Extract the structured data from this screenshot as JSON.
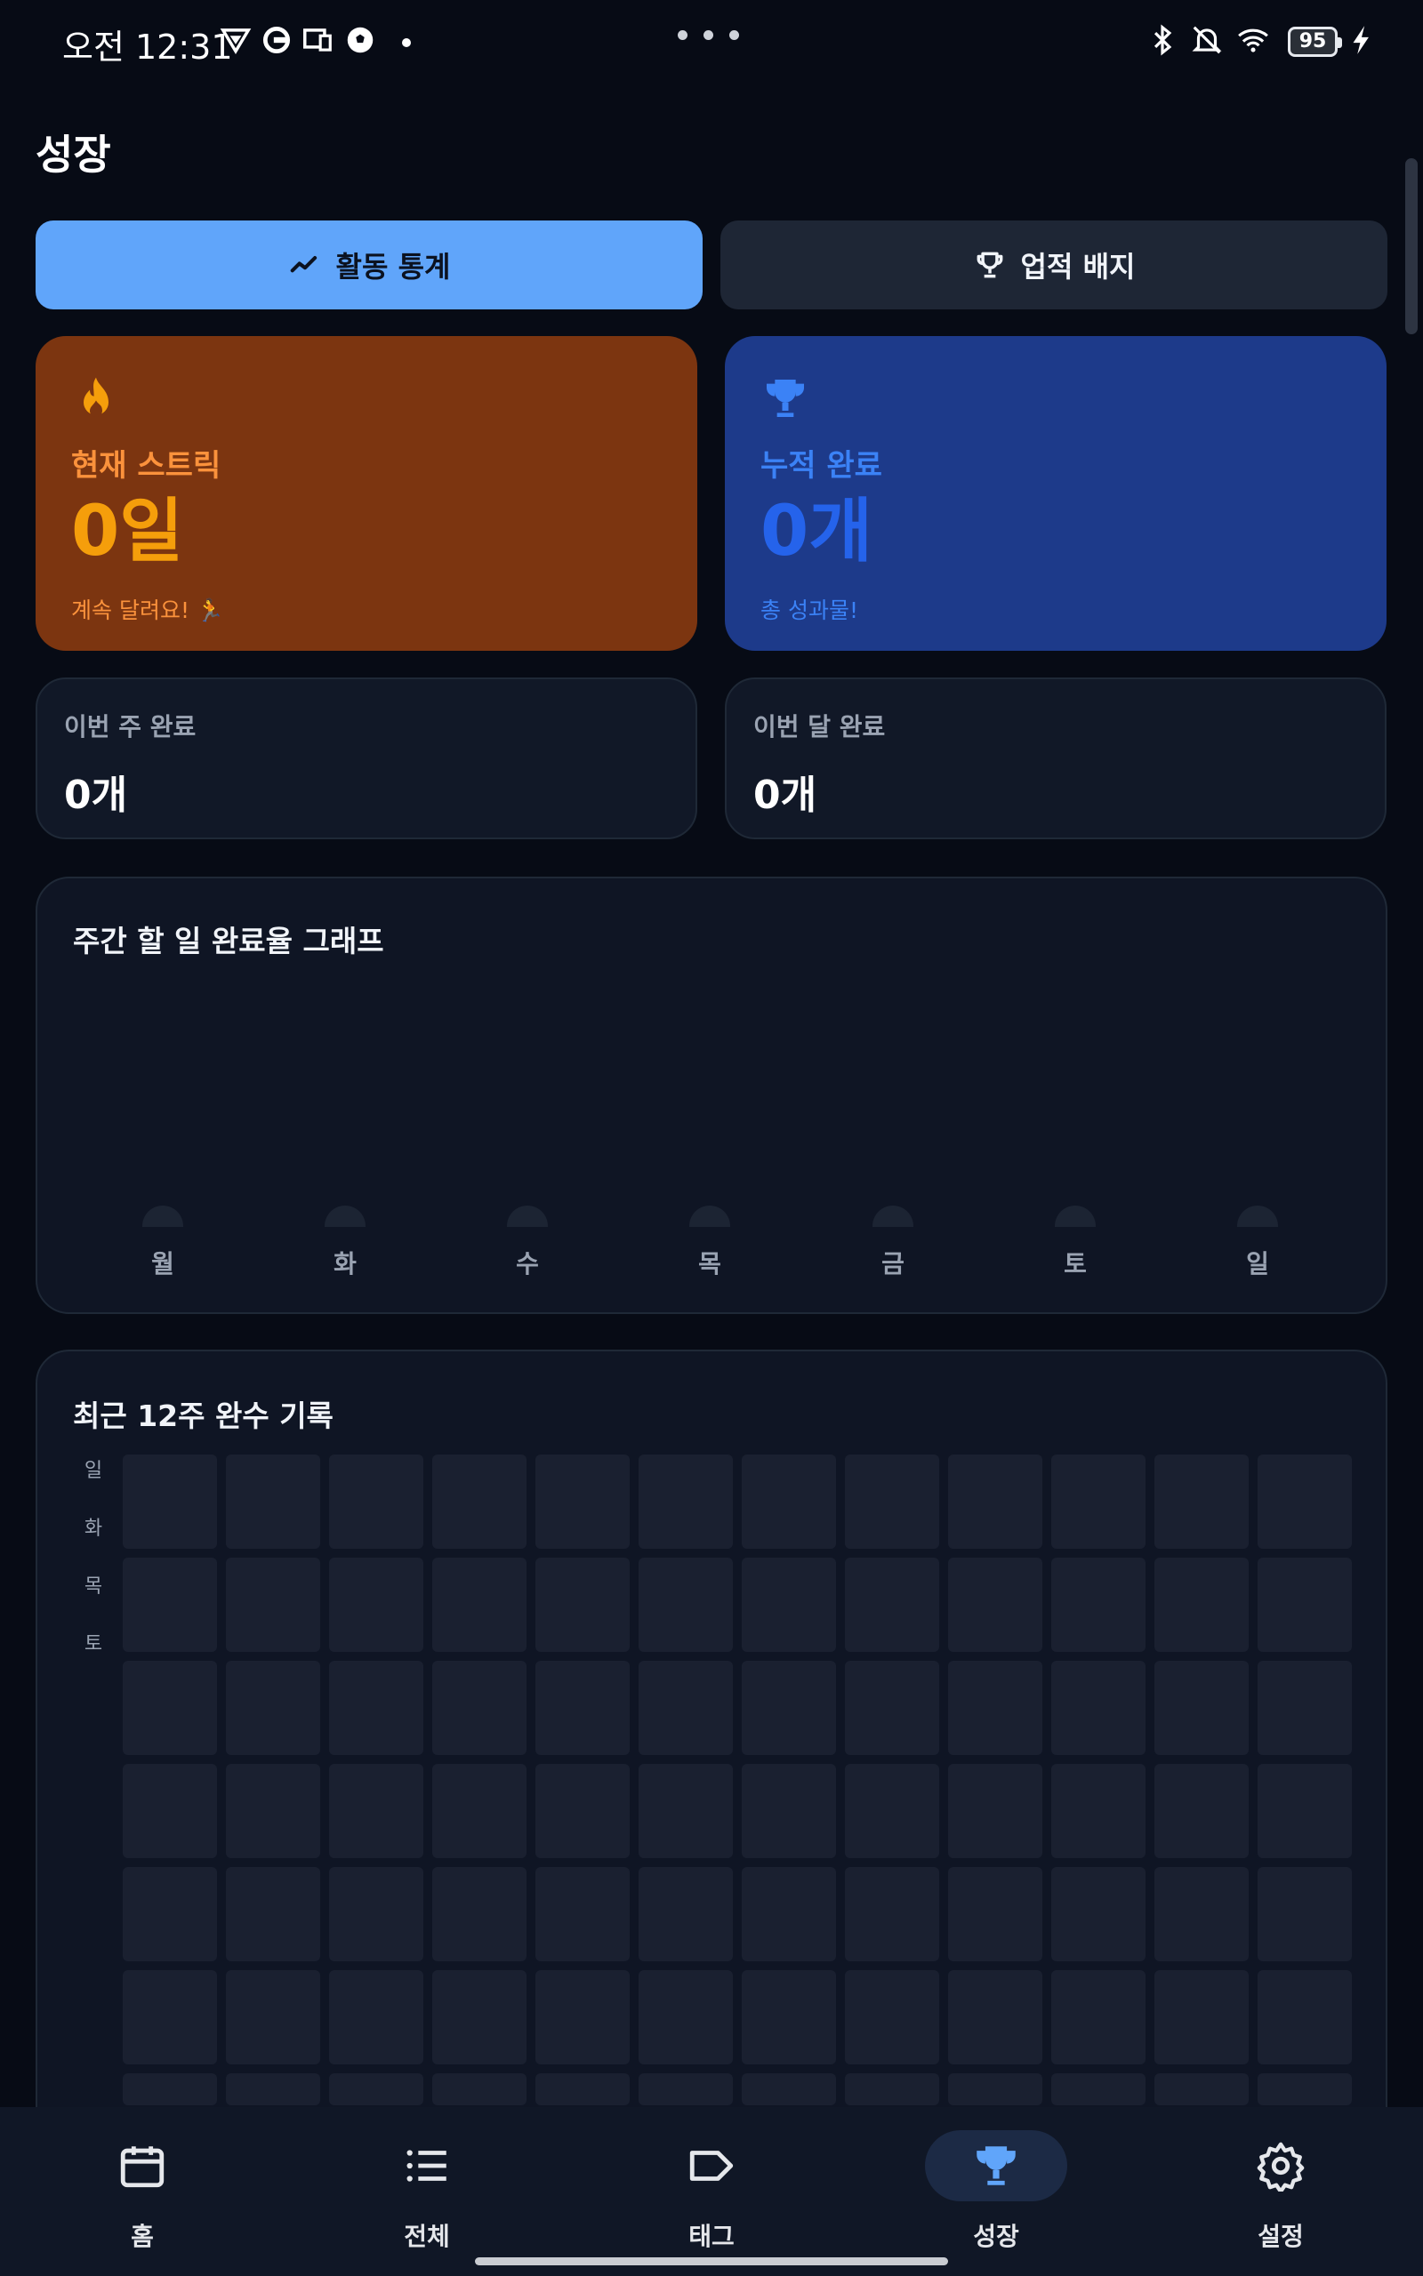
{
  "status_bar": {
    "time": "오전 12:31",
    "battery": "95",
    "icons": [
      "vpn-icon",
      "sync-icon",
      "cast-icon",
      "soccer-icon",
      "dot-icon",
      "bluetooth-icon",
      "mute-icon",
      "wifi-icon",
      "battery-icon",
      "charging-icon"
    ]
  },
  "header": {
    "title": "성장"
  },
  "tabs": [
    {
      "label": "활동 통계",
      "icon": "trend-icon",
      "active": true
    },
    {
      "label": "업적 배지",
      "icon": "trophy-icon",
      "active": false
    }
  ],
  "stats": {
    "streak": {
      "label": "현재 스트릭",
      "value": "0일",
      "sub": "계속 달려요! 🏃",
      "icon": "flame-icon",
      "color": "#7c3510"
    },
    "total": {
      "label": "누적 완료",
      "value": "0개",
      "sub": "총 성과물!",
      "icon": "trophy-icon",
      "color": "#1d3a8a"
    },
    "week": {
      "label": "이번 주 완료",
      "value": "0개"
    },
    "month": {
      "label": "이번 달 완료",
      "value": "0개"
    }
  },
  "weekly_graph": {
    "title": "주간 할 일 완료율 그래프",
    "days": [
      "월",
      "화",
      "수",
      "목",
      "금",
      "토",
      "일"
    ],
    "values": [
      0,
      0,
      0,
      0,
      0,
      0,
      0
    ]
  },
  "heatmap": {
    "title": "최근 12주 완수 기록",
    "row_labels": [
      "일",
      "화",
      "목",
      "토"
    ],
    "columns": 12,
    "values": "all empty"
  },
  "bottom_nav": [
    {
      "label": "홈",
      "icon": "calendar-icon",
      "active": false
    },
    {
      "label": "전체",
      "icon": "list-icon",
      "active": false
    },
    {
      "label": "태그",
      "icon": "tag-icon",
      "active": false
    },
    {
      "label": "성장",
      "icon": "trophy-icon",
      "active": true
    },
    {
      "label": "설정",
      "icon": "gear-icon",
      "active": false
    }
  ],
  "colors": {
    "background": "#070b15",
    "accent": "#60a5fa",
    "streak_text": "#f59e0b",
    "total_text": "#2563eb"
  }
}
